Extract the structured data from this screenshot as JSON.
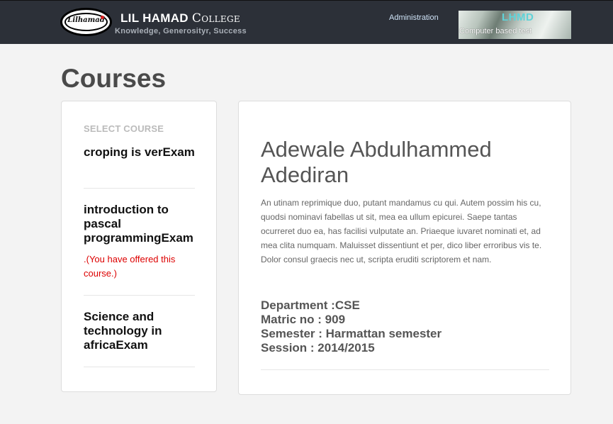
{
  "header": {
    "logo_text": "Lilhamad",
    "brand_name": "LIL HAMAD",
    "brand_suffix": "College",
    "tagline": "Knowledge, Generosityr, Success",
    "nav_admin": "Administration",
    "banner_title": "LHMD",
    "banner_subtitle": "Computer based test"
  },
  "page": {
    "title": "Courses"
  },
  "sidebar": {
    "label": "SELECT COURSE",
    "courses": [
      {
        "name": "croping is verExam"
      },
      {
        "name": "introduction to pascal programmingExam",
        "note": ".(You have offered this course.)"
      },
      {
        "name": "Science and technology in africaExam"
      }
    ]
  },
  "student": {
    "name": "Adewale Abdulhammed Adediran",
    "bio": "An utinam reprimique duo, putant mandamus cu qui. Autem possim his cu, quodsi nominavi fabellas ut sit, mea ea ullum epicurei. Saepe tantas ocurreret duo ea, has facilisi vulputate an. Priaeque iuvaret nominati et, ad mea clita numquam. Maluisset dissentiunt et per, dico liber erroribus vis te. Dolor consul graecis nec ut, scripta eruditi scriptorem et nam.",
    "department": "Department :CSE",
    "matric": "Matric no : 909",
    "semester": "Semester : Harmattan semester",
    "session": "Session : 2014/2015"
  }
}
